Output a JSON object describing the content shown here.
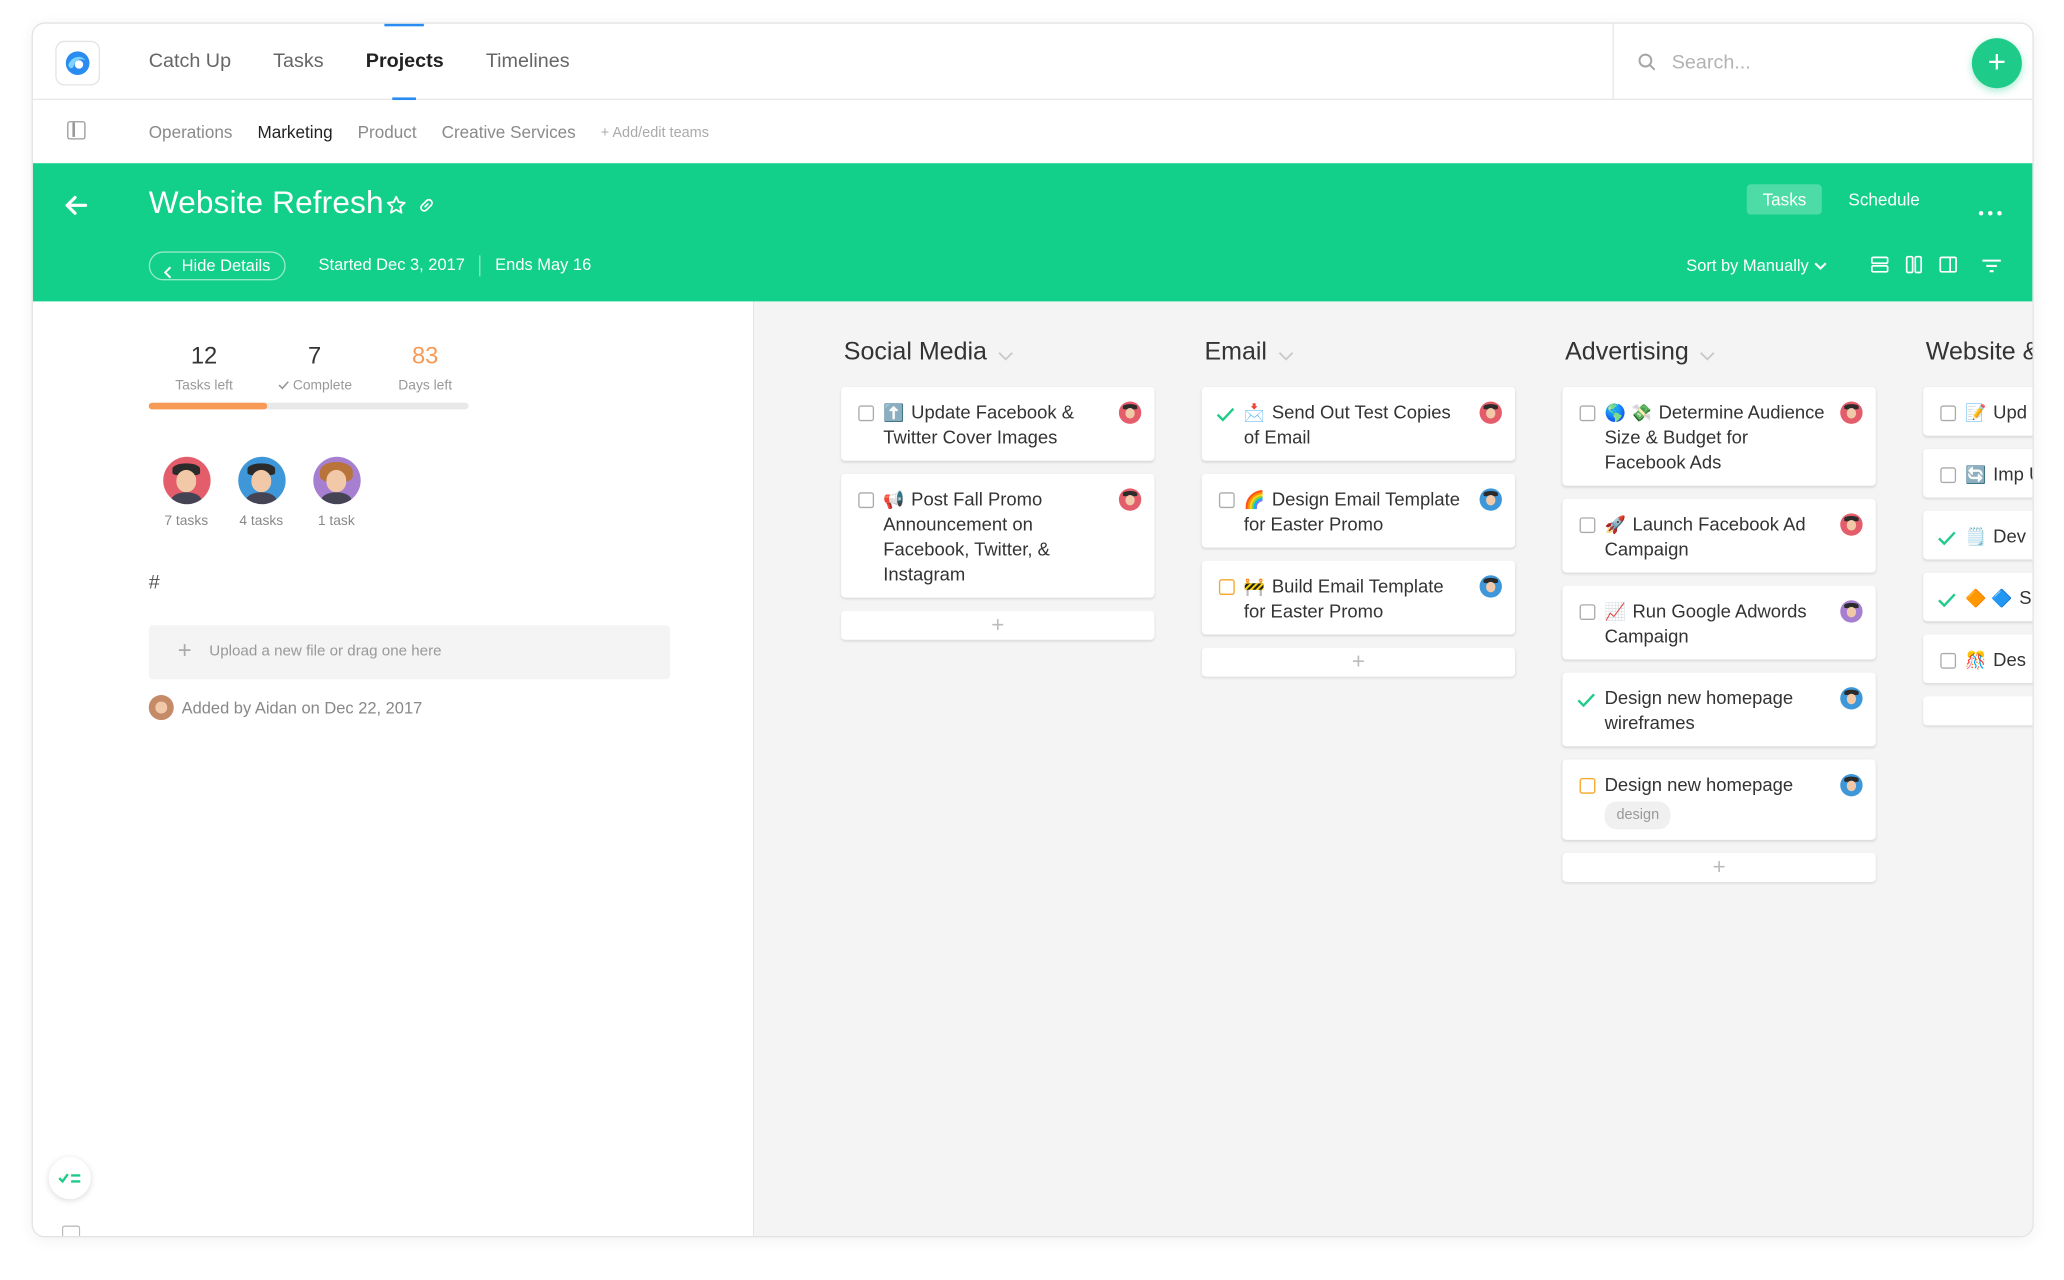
{
  "nav": {
    "items": [
      {
        "label": "Catch Up",
        "active": false
      },
      {
        "label": "Tasks",
        "active": false
      },
      {
        "label": "Projects",
        "active": true
      },
      {
        "label": "Timelines",
        "active": false
      }
    ]
  },
  "search": {
    "placeholder": "Search..."
  },
  "add_button": {
    "label": "+"
  },
  "teams": {
    "items": [
      {
        "label": "Operations",
        "active": false
      },
      {
        "label": "Marketing",
        "active": true
      },
      {
        "label": "Product",
        "active": false
      },
      {
        "label": "Creative Services",
        "active": false
      }
    ],
    "add_label": "+ Add/edit teams"
  },
  "project": {
    "title": "Website Refresh",
    "hide_details_label": "Hide Details",
    "started": "Started Dec 3, 2017",
    "ends": "Ends May 16",
    "view_tabs": [
      {
        "label": "Tasks",
        "active": true
      },
      {
        "label": "Schedule",
        "active": false
      }
    ],
    "sort_label": "Sort by Manually",
    "accent_color": "#12cf8a"
  },
  "details": {
    "stats": [
      {
        "value": "12",
        "label": "Tasks left"
      },
      {
        "value": "7",
        "label": "Complete"
      },
      {
        "value": "83",
        "label": "Days left"
      }
    ],
    "progress_fraction": 0.37,
    "members": [
      {
        "count": "7 tasks",
        "color": "#e35d6a"
      },
      {
        "count": "4 tasks",
        "color": "#3d97d9"
      },
      {
        "count": "1 task",
        "color": "#a77fd1"
      }
    ],
    "hash": "#",
    "upload_text": "Upload a new file or drag one here",
    "added_text": "Added by Aidan on Dec 22, 2017"
  },
  "columns": [
    {
      "title": "Social Media",
      "cards": [
        {
          "emoji": "⬆️",
          "text": "Update Facebook & Twitter Cover Images",
          "status": "open",
          "avatar": "red"
        },
        {
          "emoji": "📢",
          "text": "Post Fall Promo Announcement on Facebook, Twitter, & Instagram",
          "status": "open",
          "avatar": "red"
        }
      ]
    },
    {
      "title": "Email",
      "cards": [
        {
          "emoji": "📩",
          "text": "Send Out Test Copies of Email",
          "status": "done",
          "avatar": "red"
        },
        {
          "emoji": "🌈",
          "text": "Design Email Template for Easter Promo",
          "status": "open",
          "avatar": "blue"
        },
        {
          "emoji": "🚧",
          "text": "Build Email Template for Easter Promo",
          "status": "in-progress",
          "avatar": "blue"
        }
      ]
    },
    {
      "title": "Advertising",
      "cards": [
        {
          "emoji": "🌎 💸",
          "text": "Determine Audience Size & Budget for Facebook Ads",
          "status": "open",
          "avatar": "red"
        },
        {
          "emoji": "🚀",
          "text": "Launch Facebook Ad Campaign",
          "status": "open",
          "avatar": "red"
        },
        {
          "emoji": "📈",
          "text": "Run Google Adwords Campaign",
          "status": "open",
          "avatar": "purple"
        },
        {
          "emoji": "",
          "text": "Design new homepage wireframes",
          "status": "done",
          "avatar": "blue"
        },
        {
          "emoji": "",
          "text": "Design new homepage",
          "status": "in-progress",
          "avatar": "blue",
          "tag": "design"
        }
      ]
    },
    {
      "title": "Website &",
      "cards": [
        {
          "emoji": "📝",
          "text": "Upd Copy",
          "status": "open",
          "avatar": ""
        },
        {
          "emoji": "🔄",
          "text": "Imp Updates Change",
          "status": "open",
          "avatar": ""
        },
        {
          "emoji": "🗒️",
          "text": "Dev List",
          "status": "done",
          "avatar": ""
        },
        {
          "emoji": "🔶 🔷",
          "text": "S A/B Tes",
          "status": "done",
          "avatar": ""
        },
        {
          "emoji": "🎊",
          "text": "Des Banner",
          "status": "open",
          "avatar": ""
        }
      ]
    }
  ],
  "colors": {
    "green": "#12cf8a",
    "orange": "#f79a55",
    "blue": "#2a8cf0",
    "check_green": "#1fcb89",
    "in_progress_orange": "#f5a623"
  }
}
